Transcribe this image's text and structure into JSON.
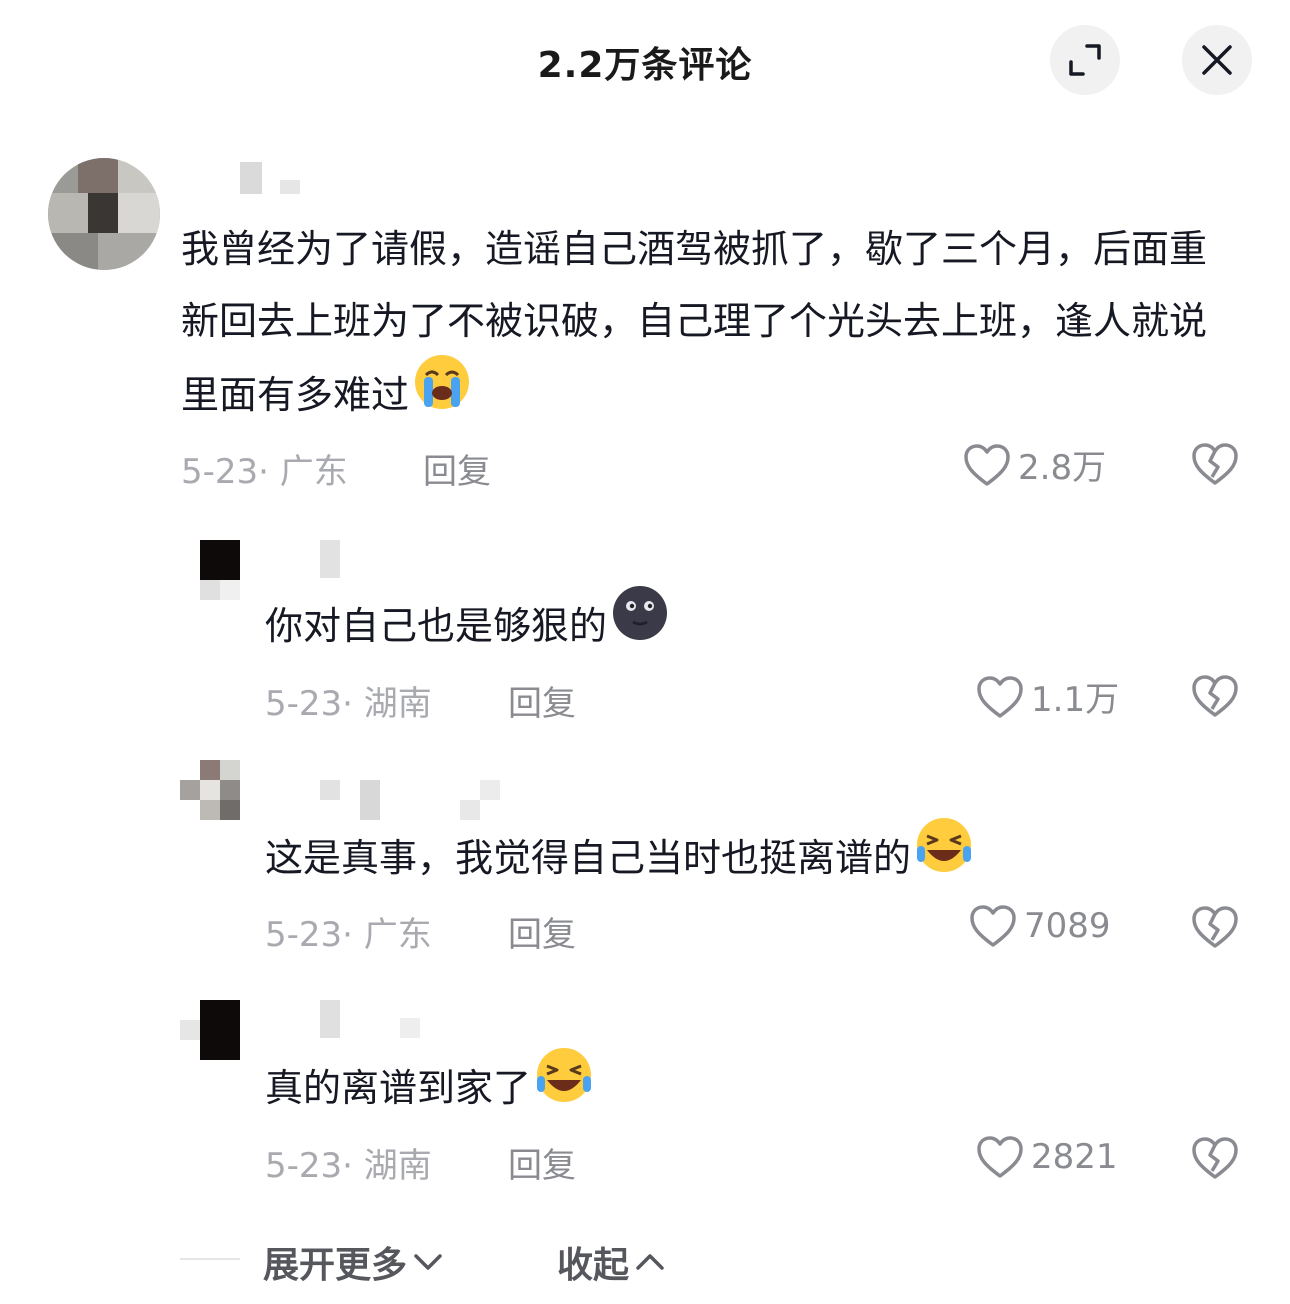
{
  "header": {
    "title": "2.2万条评论",
    "expand_icon": "expand-icon",
    "close_icon": "close-icon"
  },
  "comments": [
    {
      "text": "我曾经为了请假，造谣自己酒驾被抓了，歇了三个月，后面重新回去上班为了不被识破，自己理了个光头去上班，逢人就说里面有多难过",
      "emoji": "loudly-crying-face",
      "meta": "5-23· 广东",
      "reply": "回复",
      "likes": "2.8万"
    },
    {
      "text": "你对自己也是够狠的",
      "emoji": "new-moon-face",
      "meta": "5-23· 湖南",
      "reply": "回复",
      "likes": "1.1万"
    },
    {
      "text": "这是真事，我觉得自己当时也挺离谱的",
      "emoji": "rofl-face",
      "meta": "5-23· 广东",
      "reply": "回复",
      "likes": "7089"
    },
    {
      "text": "真的离谱到家了",
      "emoji": "rofl-face",
      "meta": "5-23· 湖南",
      "reply": "回复",
      "likes": "2821"
    }
  ],
  "footer": {
    "expand_label": "展开更多",
    "collapse_label": "收起"
  },
  "colors": {
    "text": "#161823",
    "meta": "#a9aab0",
    "button_bg": "#f1f1f2"
  }
}
